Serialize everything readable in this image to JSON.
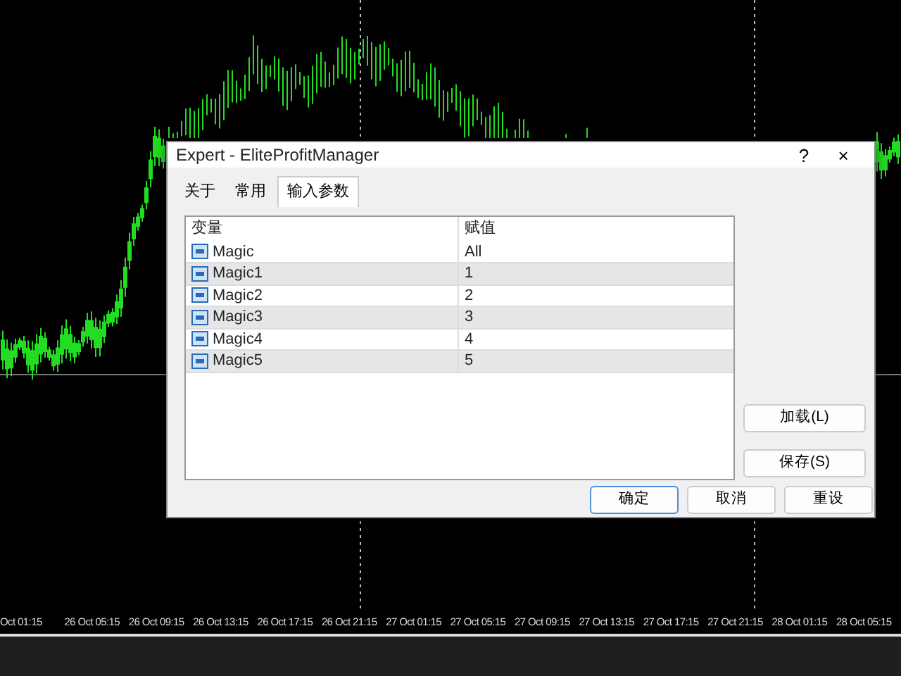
{
  "chart": {
    "time_labels": [
      "Oct 01:15",
      "26 Oct 05:15",
      "26 Oct 09:15",
      "26 Oct 13:15",
      "26 Oct 17:15",
      "26 Oct 21:15",
      "27 Oct 01:15",
      "27 Oct 05:15",
      "27 Oct 09:15",
      "27 Oct 13:15",
      "27 Oct 17:15",
      "27 Oct 21:15",
      "28 Oct 01:15",
      "28 Oct 05:15"
    ]
  },
  "window": {
    "title": "Expert - EliteProfitManager",
    "help": "?",
    "close": "×"
  },
  "tabs": [
    {
      "label": "关于",
      "selected": false
    },
    {
      "label": "常用",
      "selected": false
    },
    {
      "label": "输入参数",
      "selected": true
    }
  ],
  "table": {
    "columns": [
      "变量",
      "赋值"
    ],
    "rows": [
      {
        "name": "Magic",
        "value": "All"
      },
      {
        "name": "Magic1",
        "value": "1"
      },
      {
        "name": "Magic2",
        "value": "2"
      },
      {
        "name": "Magic3",
        "value": "3"
      },
      {
        "name": "Magic4",
        "value": "4"
      },
      {
        "name": "Magic5",
        "value": "5"
      }
    ]
  },
  "side_buttons": [
    "加载(L)",
    "保存(S)"
  ],
  "buttons": [
    {
      "label": "确定",
      "default": true
    },
    {
      "label": "取消",
      "default": false
    },
    {
      "label": "重设",
      "default": false
    }
  ]
}
